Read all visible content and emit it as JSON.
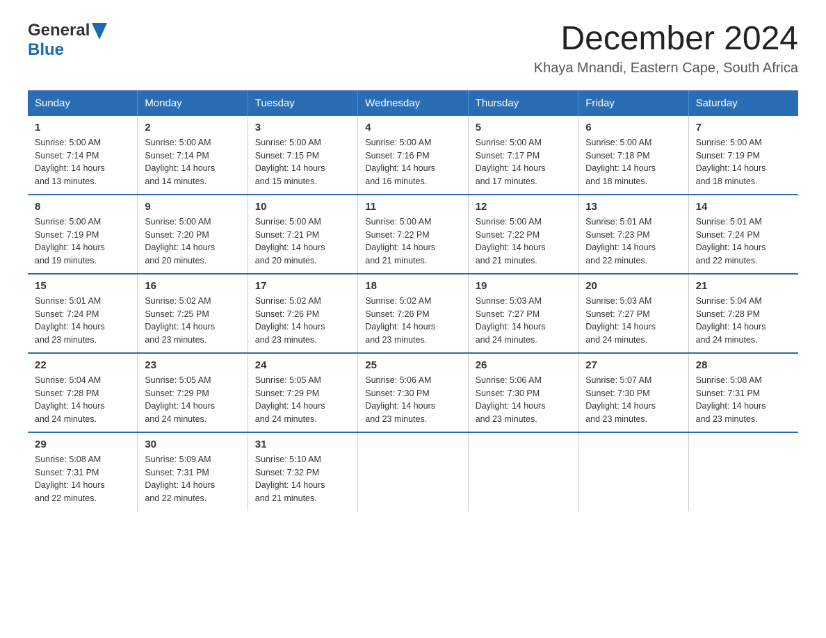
{
  "logo": {
    "line1": "General",
    "line2": "Blue",
    "arrow_color": "#1a6bb5"
  },
  "title": "December 2024",
  "subtitle": "Khaya Mnandi, Eastern Cape, South Africa",
  "header_days": [
    "Sunday",
    "Monday",
    "Tuesday",
    "Wednesday",
    "Thursday",
    "Friday",
    "Saturday"
  ],
  "weeks": [
    [
      {
        "day": "1",
        "sunrise": "5:00 AM",
        "sunset": "7:14 PM",
        "daylight": "14 hours and 13 minutes."
      },
      {
        "day": "2",
        "sunrise": "5:00 AM",
        "sunset": "7:14 PM",
        "daylight": "14 hours and 14 minutes."
      },
      {
        "day": "3",
        "sunrise": "5:00 AM",
        "sunset": "7:15 PM",
        "daylight": "14 hours and 15 minutes."
      },
      {
        "day": "4",
        "sunrise": "5:00 AM",
        "sunset": "7:16 PM",
        "daylight": "14 hours and 16 minutes."
      },
      {
        "day": "5",
        "sunrise": "5:00 AM",
        "sunset": "7:17 PM",
        "daylight": "14 hours and 17 minutes."
      },
      {
        "day": "6",
        "sunrise": "5:00 AM",
        "sunset": "7:18 PM",
        "daylight": "14 hours and 18 minutes."
      },
      {
        "day": "7",
        "sunrise": "5:00 AM",
        "sunset": "7:19 PM",
        "daylight": "14 hours and 18 minutes."
      }
    ],
    [
      {
        "day": "8",
        "sunrise": "5:00 AM",
        "sunset": "7:19 PM",
        "daylight": "14 hours and 19 minutes."
      },
      {
        "day": "9",
        "sunrise": "5:00 AM",
        "sunset": "7:20 PM",
        "daylight": "14 hours and 20 minutes."
      },
      {
        "day": "10",
        "sunrise": "5:00 AM",
        "sunset": "7:21 PM",
        "daylight": "14 hours and 20 minutes."
      },
      {
        "day": "11",
        "sunrise": "5:00 AM",
        "sunset": "7:22 PM",
        "daylight": "14 hours and 21 minutes."
      },
      {
        "day": "12",
        "sunrise": "5:00 AM",
        "sunset": "7:22 PM",
        "daylight": "14 hours and 21 minutes."
      },
      {
        "day": "13",
        "sunrise": "5:01 AM",
        "sunset": "7:23 PM",
        "daylight": "14 hours and 22 minutes."
      },
      {
        "day": "14",
        "sunrise": "5:01 AM",
        "sunset": "7:24 PM",
        "daylight": "14 hours and 22 minutes."
      }
    ],
    [
      {
        "day": "15",
        "sunrise": "5:01 AM",
        "sunset": "7:24 PM",
        "daylight": "14 hours and 23 minutes."
      },
      {
        "day": "16",
        "sunrise": "5:02 AM",
        "sunset": "7:25 PM",
        "daylight": "14 hours and 23 minutes."
      },
      {
        "day": "17",
        "sunrise": "5:02 AM",
        "sunset": "7:26 PM",
        "daylight": "14 hours and 23 minutes."
      },
      {
        "day": "18",
        "sunrise": "5:02 AM",
        "sunset": "7:26 PM",
        "daylight": "14 hours and 23 minutes."
      },
      {
        "day": "19",
        "sunrise": "5:03 AM",
        "sunset": "7:27 PM",
        "daylight": "14 hours and 24 minutes."
      },
      {
        "day": "20",
        "sunrise": "5:03 AM",
        "sunset": "7:27 PM",
        "daylight": "14 hours and 24 minutes."
      },
      {
        "day": "21",
        "sunrise": "5:04 AM",
        "sunset": "7:28 PM",
        "daylight": "14 hours and 24 minutes."
      }
    ],
    [
      {
        "day": "22",
        "sunrise": "5:04 AM",
        "sunset": "7:28 PM",
        "daylight": "14 hours and 24 minutes."
      },
      {
        "day": "23",
        "sunrise": "5:05 AM",
        "sunset": "7:29 PM",
        "daylight": "14 hours and 24 minutes."
      },
      {
        "day": "24",
        "sunrise": "5:05 AM",
        "sunset": "7:29 PM",
        "daylight": "14 hours and 24 minutes."
      },
      {
        "day": "25",
        "sunrise": "5:06 AM",
        "sunset": "7:30 PM",
        "daylight": "14 hours and 23 minutes."
      },
      {
        "day": "26",
        "sunrise": "5:06 AM",
        "sunset": "7:30 PM",
        "daylight": "14 hours and 23 minutes."
      },
      {
        "day": "27",
        "sunrise": "5:07 AM",
        "sunset": "7:30 PM",
        "daylight": "14 hours and 23 minutes."
      },
      {
        "day": "28",
        "sunrise": "5:08 AM",
        "sunset": "7:31 PM",
        "daylight": "14 hours and 23 minutes."
      }
    ],
    [
      {
        "day": "29",
        "sunrise": "5:08 AM",
        "sunset": "7:31 PM",
        "daylight": "14 hours and 22 minutes."
      },
      {
        "day": "30",
        "sunrise": "5:09 AM",
        "sunset": "7:31 PM",
        "daylight": "14 hours and 22 minutes."
      },
      {
        "day": "31",
        "sunrise": "5:10 AM",
        "sunset": "7:32 PM",
        "daylight": "14 hours and 21 minutes."
      },
      null,
      null,
      null,
      null
    ]
  ],
  "labels": {
    "sunrise": "Sunrise:",
    "sunset": "Sunset:",
    "daylight": "Daylight:"
  }
}
